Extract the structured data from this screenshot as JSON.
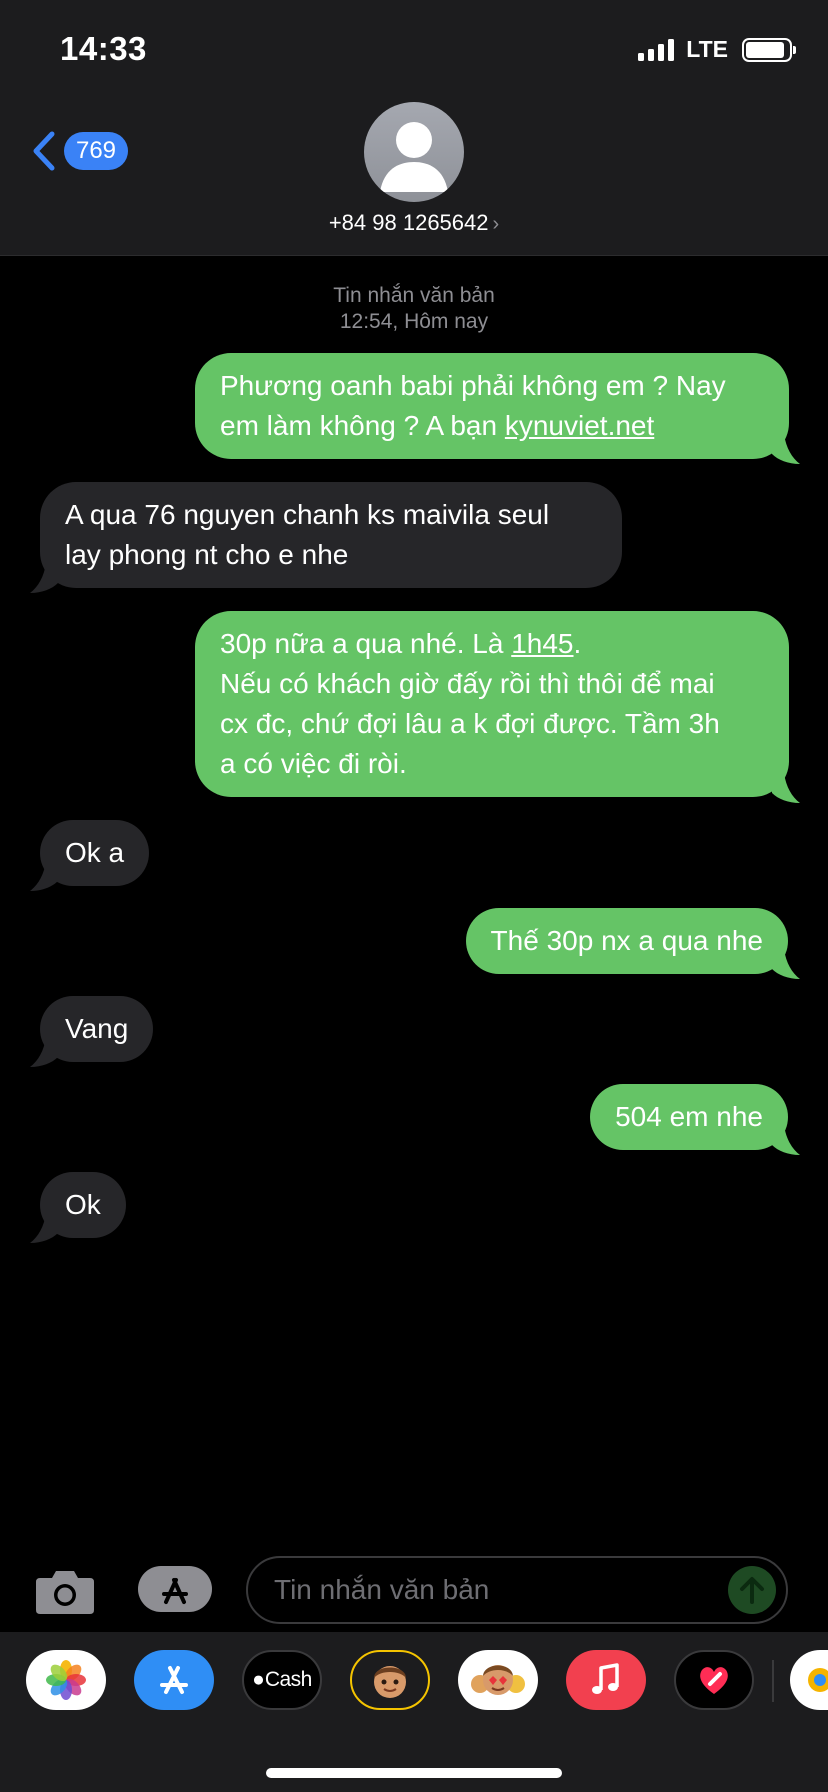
{
  "status": {
    "time": "14:33",
    "network": "LTE",
    "battery_level": 0.9
  },
  "header": {
    "back_count": "769",
    "contact": "+84 98 1265642",
    "contact_chevron": "›"
  },
  "thread": {
    "service": "Tin nhắn văn bản",
    "time": "12:54, Hôm nay"
  },
  "messages": [
    {
      "dir": "out",
      "text": [
        "Phương oanh babi phải không em ? Nay",
        "em làm không ? A bạn "
      ],
      "link": "kynuviet.net"
    },
    {
      "dir": "in",
      "text": [
        "A qua 76 nguyen chanh ks maivila seul",
        "lay phong nt cho e nhe"
      ]
    },
    {
      "dir": "out",
      "pre": "30p nữa a qua nhé. Là ",
      "link": "1h45",
      "post": ".",
      "text": [
        "Nếu có khách giờ đấy rồi thì thôi để mai",
        "cx đc, chứ đợi lâu a k đợi được. Tầm 3h",
        "a có việc đi ròi."
      ]
    },
    {
      "dir": "in",
      "text": [
        "Ok a"
      ]
    },
    {
      "dir": "out",
      "text": [
        "Thế 30p nx a qua nhe"
      ]
    },
    {
      "dir": "in",
      "text": [
        "Vang"
      ]
    },
    {
      "dir": "out",
      "text": [
        "504 em nhe"
      ]
    },
    {
      "dir": "in",
      "text": [
        "Ok"
      ]
    }
  ],
  "composer": {
    "placeholder": "Tin nhắn văn bản",
    "camera_icon": "camera-icon",
    "apps_icon": "app-store-icon",
    "send_icon": "arrow-up-icon"
  },
  "app_drawer": {
    "apps": [
      {
        "name": "photos-app-icon"
      },
      {
        "name": "app-store-app-icon"
      },
      {
        "name": "apple-cash-app-icon",
        "label": "Cash"
      },
      {
        "name": "memoji-app-icon"
      },
      {
        "name": "memoji-stickers-app-icon"
      },
      {
        "name": "music-app-icon"
      },
      {
        "name": "digital-touch-app-icon"
      },
      {
        "name": "more-app-icon"
      }
    ]
  },
  "colors": {
    "outgoing_bubble": "#65c466",
    "incoming_bubble": "#262629",
    "accent": "#3a82f6",
    "background": "#000000",
    "bar": "#1c1c1e"
  }
}
